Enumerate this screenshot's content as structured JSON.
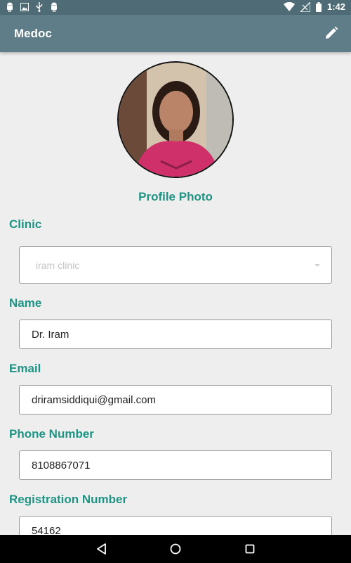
{
  "status_bar": {
    "time": "1:42",
    "icons": [
      "android-icon",
      "image-icon",
      "usb-icon",
      "android-icon",
      "wifi-icon",
      "signal-icon",
      "battery-icon"
    ]
  },
  "app_bar": {
    "title": "Medoc",
    "action_icon": "edit-icon"
  },
  "profile": {
    "photo_label": "Profile Photo"
  },
  "form": {
    "clinic": {
      "label": "Clinic",
      "value": "iram  clinic"
    },
    "name": {
      "label": "Name",
      "value": "Dr. Iram"
    },
    "email": {
      "label": "Email",
      "value": "driramsiddiqui@gmail.com"
    },
    "phone": {
      "label": "Phone Number",
      "value": "8108867071"
    },
    "registration": {
      "label": "Registration Number",
      "value": "54162"
    }
  },
  "nav_bar": {
    "icons": [
      "back-icon",
      "home-icon",
      "recents-icon"
    ]
  },
  "colors": {
    "status_bar": "#4f6b76",
    "app_bar": "#5f7d89",
    "accent": "#1f9384",
    "background": "#eeeeee"
  }
}
